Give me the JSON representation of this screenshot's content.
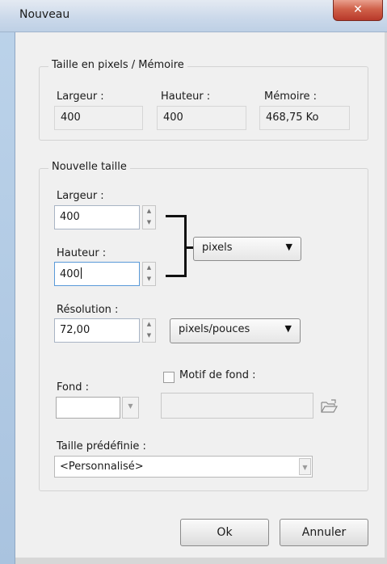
{
  "window": {
    "title": "Nouveau",
    "close_glyph": "✕"
  },
  "memory_group": {
    "title": "Taille en pixels / Mémoire",
    "width_label": "Largeur :",
    "width_value": "400",
    "height_label": "Hauteur :",
    "height_value": "400",
    "memory_label": "Mémoire :",
    "memory_value": "468,75 Ko"
  },
  "new_size_group": {
    "title": "Nouvelle taille",
    "width_label": "Largeur :",
    "width_value": "400",
    "height_label": "Hauteur :",
    "height_value": "400",
    "unit_selected": "pixels",
    "resolution_label": "Résolution :",
    "resolution_value": "72,00",
    "resolution_unit_selected": "pixels/pouces",
    "background_label": "Fond :",
    "background_color": "#ffffff",
    "pattern_checkbox_label": "Motif de fond :",
    "pattern_checked": false,
    "preset_label": "Taille prédéfinie :",
    "preset_selected": "<Personnalisé>"
  },
  "buttons": {
    "ok_label": "Ok",
    "cancel_label": "Annuler"
  },
  "icons": {
    "spin_up": "▲",
    "spin_down": "▼",
    "dropdown": "▼",
    "folder": "folder-open-icon"
  },
  "colors": {
    "accent": "#5a9ad8",
    "close_button": "#c84a36"
  }
}
